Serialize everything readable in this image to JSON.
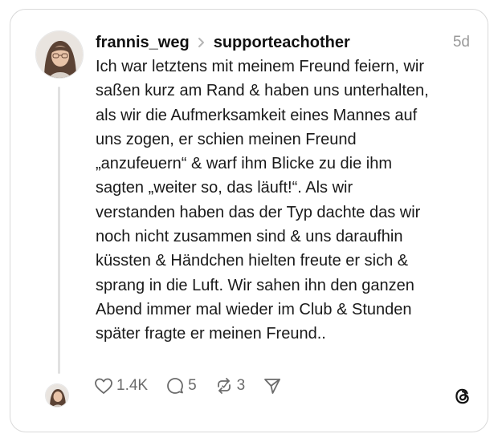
{
  "post": {
    "username": "frannis_weg",
    "community": "supporteachother",
    "time": "5d",
    "text": "Ich war letztens mit meinem Freund feiern, wir\nsaßen kurz am Rand & haben uns unterhalten,\nals wir die Aufmerksamkeit eines Mannes auf\nuns zogen, er schien meinen Freund\n„anzufeuern“ & warf ihm Blicke zu die ihm\nsagten „weiter so, das läuft!“. Als wir\nverstanden haben das der Typ dachte das wir\nnoch nicht zusammen sind & uns daraufhin\nküssten & Händchen hielten freute er sich &\nsprang in die Luft. Wir sahen ihn den ganzen\nAbend immer mal wieder im Club & Stunden\nspäter fragte er meinen Freund.."
  },
  "actions": {
    "likes": "1.4K",
    "replies": "5",
    "reposts": "3"
  },
  "icons": {
    "avatar": "avatar-photo",
    "chevron": "chevron-right-icon",
    "like": "heart-icon",
    "reply": "comment-icon",
    "repost": "repost-icon",
    "share": "send-icon",
    "brand": "threads-logo"
  },
  "colors": {
    "border": "#d9d9d9",
    "muted": "#9a9a9a",
    "text": "#111111"
  }
}
